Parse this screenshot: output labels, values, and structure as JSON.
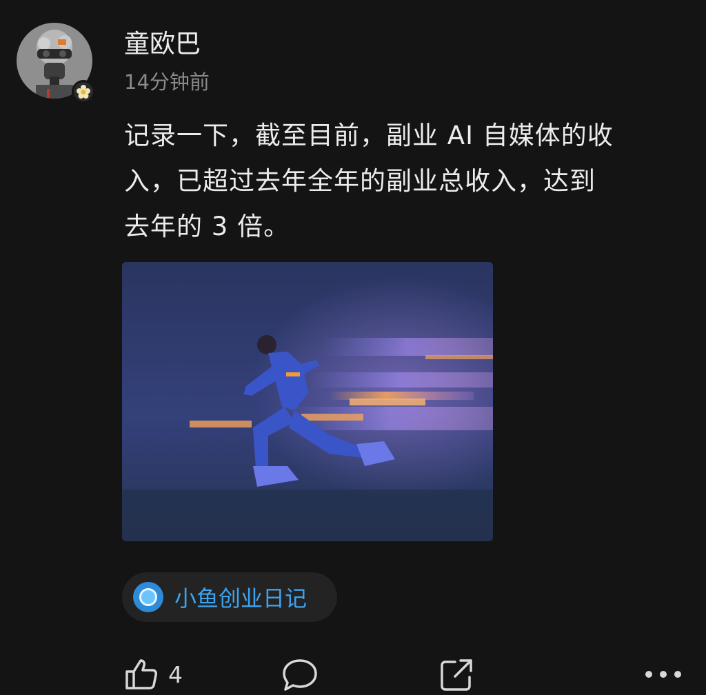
{
  "post": {
    "author": "童欧巴",
    "time": "14分钟前",
    "content_lines": [
      "记录一下，截至目前，副业 AI 自媒体的收",
      "入，已超过去年全年的副业总收入，达到",
      "去年的 3 倍。"
    ],
    "topic": "小鱼创业日记",
    "likes": "4"
  },
  "icons": {
    "badge": "flower-badge-icon",
    "topic": "topic-circle-icon",
    "like": "thumbs-up-icon",
    "comment": "comment-bubble-icon",
    "share": "share-icon",
    "more": "more-dots-icon"
  },
  "colors": {
    "background": "#141414",
    "accent": "#3ea3f0",
    "muted_text": "#8a8a8a"
  }
}
